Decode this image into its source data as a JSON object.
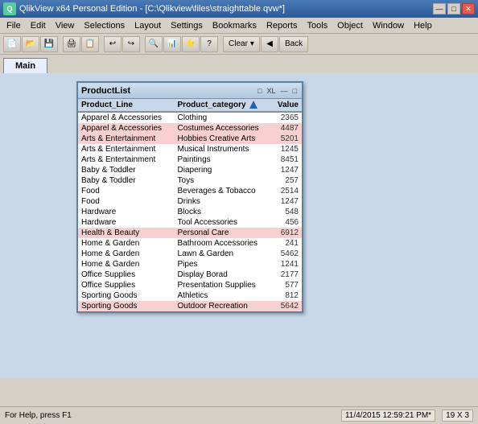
{
  "titleBar": {
    "icon": "Q",
    "title": "QlikView x64 Personal Edition - [C:\\Qlikview\\files\\straighttable.qvw*]",
    "controls": [
      "—",
      "□",
      "✕"
    ]
  },
  "menuBar": {
    "items": [
      "File",
      "Edit",
      "View",
      "Selections",
      "Layout",
      "Settings",
      "Bookmarks",
      "Reports",
      "Tools",
      "Object",
      "Window",
      "Help"
    ]
  },
  "tabs": [
    {
      "label": "Main",
      "active": true
    }
  ],
  "tableWidget": {
    "title": "ProductList",
    "controls": [
      "□",
      "XL",
      "—",
      "□"
    ],
    "columns": [
      "Product_Line",
      "Product_category",
      "Value"
    ],
    "rows": [
      {
        "product_line": "Apparel & Accessories",
        "product_category": "Clothing",
        "value": "2365",
        "style": "row-white"
      },
      {
        "product_line": "Apparel & Accessories",
        "product_category": "Costumes Accessories",
        "value": "4487",
        "style": "row-pink"
      },
      {
        "product_line": "Arts & Entertainment",
        "product_category": "Hobbies Creative Arts",
        "value": "5201",
        "style": "row-pink"
      },
      {
        "product_line": "Arts & Entertainment",
        "product_category": "Musical Instruments",
        "value": "1245",
        "style": "row-white"
      },
      {
        "product_line": "Arts & Entertainment",
        "product_category": "Paintings",
        "value": "8451",
        "style": "row-white"
      },
      {
        "product_line": "Baby & Toddler",
        "product_category": "Diapering",
        "value": "1247",
        "style": "row-white"
      },
      {
        "product_line": "Baby & Toddler",
        "product_category": "Toys",
        "value": "257",
        "style": "row-white"
      },
      {
        "product_line": "Food",
        "product_category": "Beverages & Tobacco",
        "value": "2514",
        "style": "row-white"
      },
      {
        "product_line": "Food",
        "product_category": "Drinks",
        "value": "1247",
        "style": "row-white"
      },
      {
        "product_line": "Hardware",
        "product_category": "Blocks",
        "value": "548",
        "style": "row-white"
      },
      {
        "product_line": "Hardware",
        "product_category": "Tool Accessories",
        "value": "456",
        "style": "row-white"
      },
      {
        "product_line": "Health & Beauty",
        "product_category": "Personal Care",
        "value": "6912",
        "style": "row-pink"
      },
      {
        "product_line": "Home & Garden",
        "product_category": "Bathroom Accessories",
        "value": "241",
        "style": "row-white"
      },
      {
        "product_line": "Home & Garden",
        "product_category": "Lawn & Garden",
        "value": "5462",
        "style": "row-white"
      },
      {
        "product_line": "Home & Garden",
        "product_category": "Pipes",
        "value": "1241",
        "style": "row-white"
      },
      {
        "product_line": "Office Supplies",
        "product_category": "Display Borad",
        "value": "2177",
        "style": "row-white"
      },
      {
        "product_line": "Office Supplies",
        "product_category": "Presentation Supplies",
        "value": "577",
        "style": "row-white"
      },
      {
        "product_line": "Sporting Goods",
        "product_category": "Athletics",
        "value": "812",
        "style": "row-white"
      },
      {
        "product_line": "Sporting Goods",
        "product_category": "Outdoor Recreation",
        "value": "5642",
        "style": "row-pink"
      }
    ]
  },
  "toolbar": {
    "clearLabel": "Clear",
    "backLabel": "Back"
  },
  "statusBar": {
    "helpText": "For Help, press F1",
    "datetime": "11/4/2015 12:59:21 PM*",
    "dimensions": "19 X 3"
  }
}
